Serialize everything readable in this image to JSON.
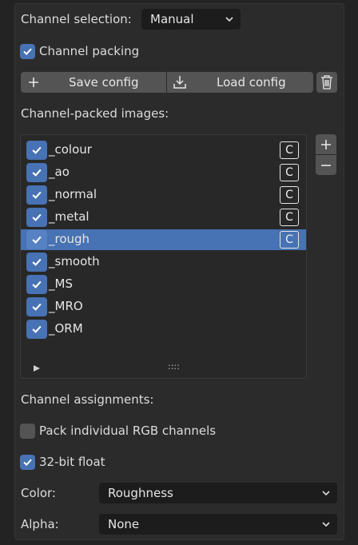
{
  "channel_selection": {
    "label": "Channel selection:",
    "value": "Manual"
  },
  "channel_packing": {
    "label": "Channel packing",
    "checked": true
  },
  "config_buttons": {
    "save_label": "Save config",
    "load_label": "Load config"
  },
  "packed_images": {
    "heading": "Channel-packed images:",
    "items": [
      {
        "name": "_colour",
        "checked": true,
        "badge": "C"
      },
      {
        "name": "_ao",
        "checked": true,
        "badge": "C"
      },
      {
        "name": "_normal",
        "checked": true,
        "badge": "C"
      },
      {
        "name": "_metal",
        "checked": true,
        "badge": "C"
      },
      {
        "name": "_rough",
        "checked": true,
        "badge": "C",
        "selected": true
      },
      {
        "name": "_smooth",
        "checked": true,
        "badge": ""
      },
      {
        "name": "_MS",
        "checked": true,
        "badge": ""
      },
      {
        "name": "_MRO",
        "checked": true,
        "badge": ""
      },
      {
        "name": "_ORM",
        "checked": true,
        "badge": ""
      }
    ],
    "grip": "::::"
  },
  "channel_assignments": {
    "heading": "Channel assignments:"
  },
  "pack_rgb": {
    "label": "Pack individual RGB channels",
    "checked": false
  },
  "float32": {
    "label": "32-bit float",
    "checked": true
  },
  "color_select": {
    "label": "Color:",
    "value": "Roughness"
  },
  "alpha_select": {
    "label": "Alpha:",
    "value": "None"
  },
  "colors": {
    "accent": "#4772b3",
    "panel": "#2b2b2b",
    "field": "#1c1c1c",
    "button": "#545454"
  }
}
